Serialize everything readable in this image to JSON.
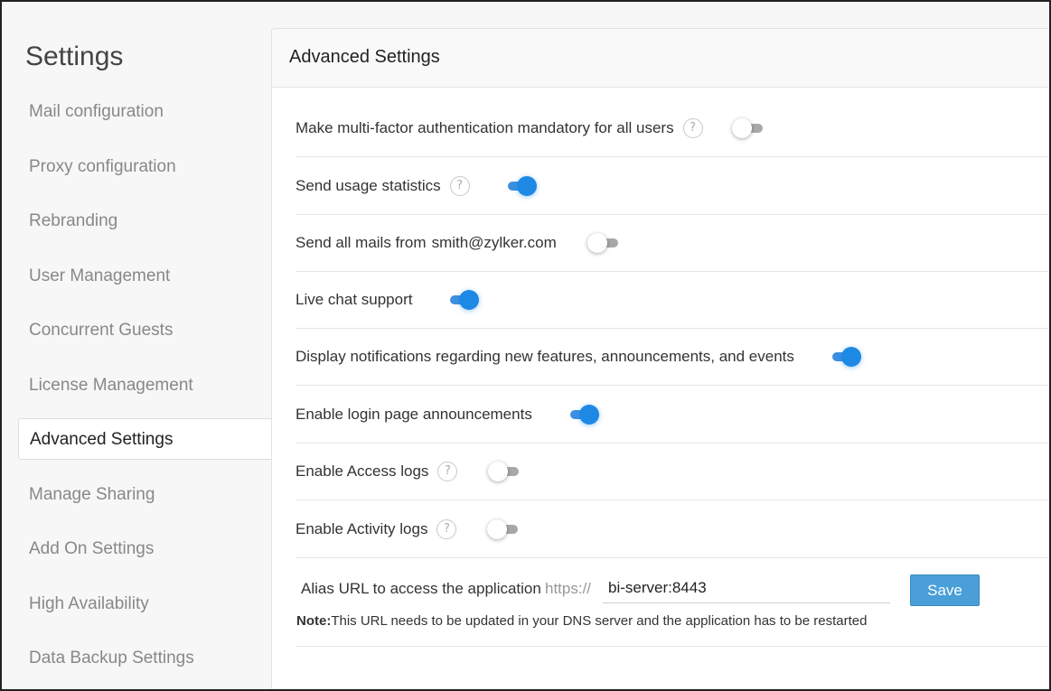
{
  "sidebar": {
    "title": "Settings",
    "items": [
      {
        "label": "Mail configuration",
        "active": false
      },
      {
        "label": "Proxy configuration",
        "active": false
      },
      {
        "label": "Rebranding",
        "active": false
      },
      {
        "label": "User Management",
        "active": false
      },
      {
        "label": "Concurrent Guests",
        "active": false
      },
      {
        "label": "License Management",
        "active": false
      },
      {
        "label": "Advanced Settings",
        "active": true
      },
      {
        "label": "Manage Sharing",
        "active": false
      },
      {
        "label": "Add On Settings",
        "active": false
      },
      {
        "label": "High Availability",
        "active": false
      },
      {
        "label": "Data Backup Settings",
        "active": false
      }
    ]
  },
  "panel": {
    "title": "Advanced Settings",
    "settings": [
      {
        "label": "Make multi-factor authentication mandatory for all users",
        "help": "?",
        "enabled": false
      },
      {
        "label": "Send usage statistics",
        "help": "?",
        "enabled": true
      },
      {
        "label": "Send all mails from",
        "email": "smith@zylker.com",
        "enabled": false
      },
      {
        "label": "Live chat support",
        "enabled": true
      },
      {
        "label": "Display notifications regarding new features, announcements, and events",
        "enabled": true
      },
      {
        "label": "Enable login page announcements",
        "enabled": true
      },
      {
        "label": "Enable Access logs",
        "help": "?",
        "enabled": false
      },
      {
        "label": "Enable Activity logs",
        "help": "?",
        "enabled": false
      }
    ],
    "alias": {
      "label": "Alias URL to access the application",
      "prefix": "https://",
      "value": "bi-server:8443",
      "save_label": "Save",
      "note_bold": "Note:",
      "note_text": "This URL needs to be updated in your DNS server and the application has to be restarted"
    }
  },
  "colors": {
    "toggle_on": "#1e88e5",
    "toggle_off": "#a8a8a8",
    "save_button": "#4a9fd8"
  }
}
